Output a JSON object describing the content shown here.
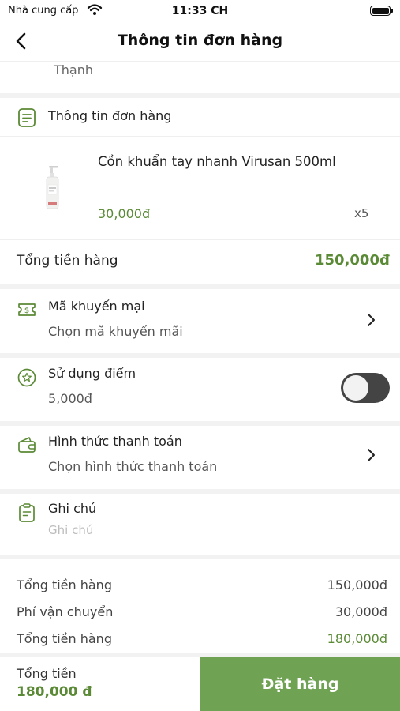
{
  "status_bar": {
    "carrier": "Nhà cung cấp",
    "time": "11:33 CH"
  },
  "header": {
    "title": "Thông tin đơn hàng"
  },
  "address_tail": "Thạnh",
  "order_section": {
    "title": "Thông tin đơn hàng",
    "item": {
      "name": "Cồn khuẩn tay nhanh Virusan 500ml",
      "price": "30,000đ",
      "qty": "x5"
    },
    "subtotal_label": "Tổng tiền hàng",
    "subtotal_value": "150,000đ"
  },
  "promo": {
    "title": "Mã khuyến mại",
    "placeholder": "Chọn mã khuyến mãi"
  },
  "points": {
    "title": "Sử dụng điểm",
    "value": "5,000đ",
    "enabled": false
  },
  "payment": {
    "title": "Hình thức thanh toán",
    "placeholder": "Chọn hình thức thanh toán"
  },
  "note": {
    "title": "Ghi chú",
    "placeholder": "Ghi chú"
  },
  "summary": {
    "rows": [
      {
        "label": "Tổng tiền hàng",
        "value": "150,000đ"
      },
      {
        "label": "Phí vận chuyển",
        "value": "30,000đ"
      },
      {
        "label": "Tổng tiền hàng",
        "value": "180,000đ"
      }
    ]
  },
  "footer": {
    "total_label": "Tổng tiền",
    "total_value": "180,000 đ",
    "order_button": "Đặt hàng"
  },
  "colors": {
    "accent": "#5b8a36",
    "button": "#6fa353",
    "toggle_off": "#444444"
  }
}
